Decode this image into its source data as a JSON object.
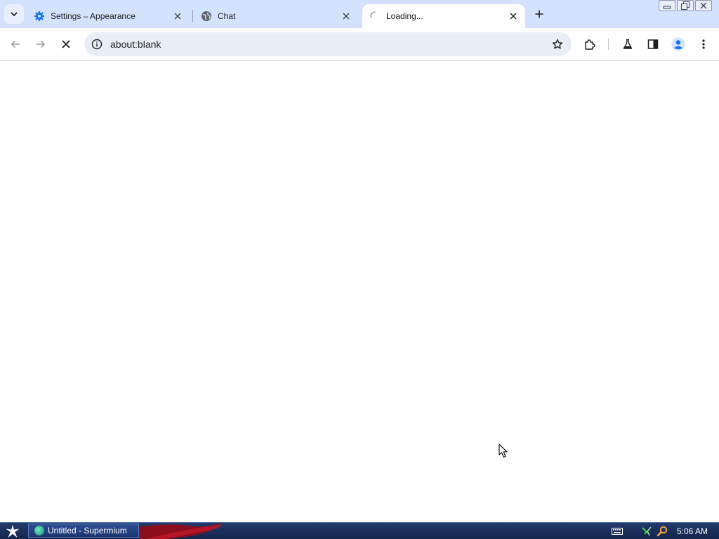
{
  "tabs": [
    {
      "title": "Settings – Appearance",
      "favicon": "gear-icon",
      "active": false
    },
    {
      "title": "Chat",
      "favicon": "globe-icon",
      "active": false
    },
    {
      "title": "Loading...",
      "favicon": "loading-spinner-icon",
      "active": true
    }
  ],
  "toolbar": {
    "url": "about:blank",
    "buttons": [
      "back-icon",
      "forward-icon",
      "stop-icon",
      "bookmark-star-icon",
      "extensions-icon",
      "labs-flask-icon",
      "side-panel-icon",
      "profile-icon",
      "menu-icon"
    ]
  },
  "taskbar": {
    "task_label": "Untitled - Supermium",
    "clock": "5:06 AM"
  },
  "colors": {
    "tabstrip": "#d3e3fd",
    "omnibox": "#e9eef6",
    "accent": "#1a73e8",
    "taskbar": "#1c3570"
  }
}
